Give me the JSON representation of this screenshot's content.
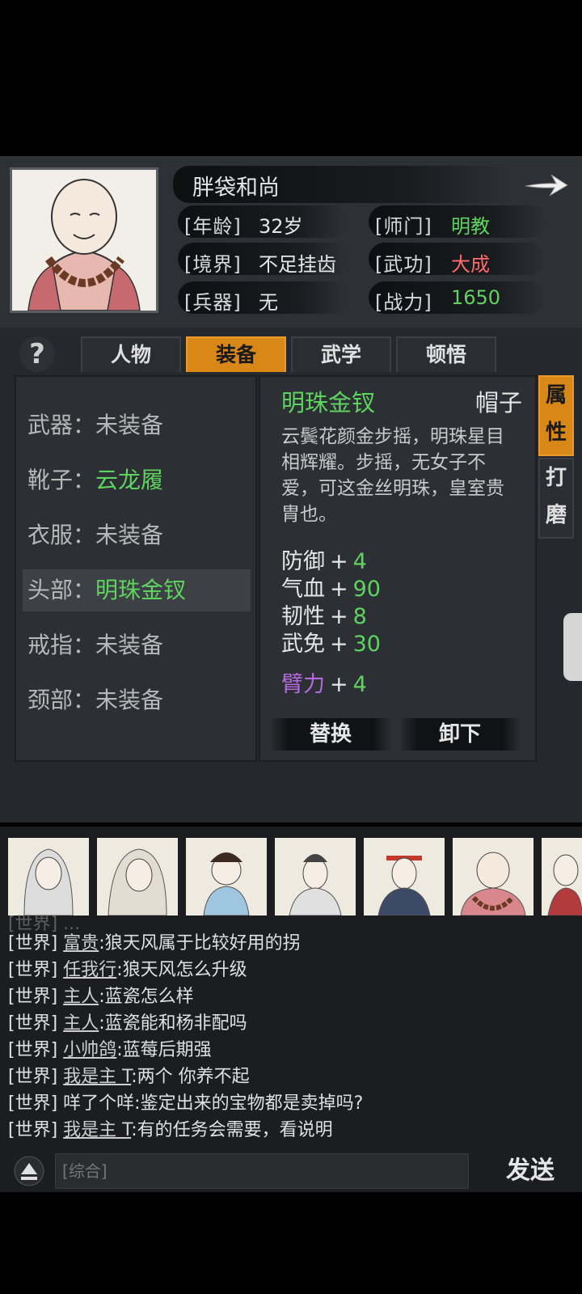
{
  "character": {
    "name": "胖袋和尚",
    "stats": [
      {
        "label": "[年龄]",
        "value": "32岁",
        "color": "#e6e6e6"
      },
      {
        "label": "[境界]",
        "value": "不足挂齿",
        "color": "#e6e6e6"
      },
      {
        "label": "[兵器]",
        "value": "无",
        "color": "#e6e6e6"
      },
      {
        "label": "[师门]",
        "value": "明教",
        "color": "#5fd35f"
      },
      {
        "label": "[武功]",
        "value": "大成",
        "color": "#ff6a6a"
      },
      {
        "label": "[战力]",
        "value": "1650",
        "color": "#5fd35f"
      }
    ]
  },
  "tabs": {
    "help": "?",
    "items": [
      "人物",
      "装备",
      "武学",
      "顿悟"
    ],
    "active": "装备"
  },
  "slots": [
    {
      "label": "武器：",
      "value": "未装备",
      "equipped": false
    },
    {
      "label": "靴子：",
      "value": "云龙履",
      "equipped": true
    },
    {
      "label": "衣服：",
      "value": "未装备",
      "equipped": false
    },
    {
      "label": "头部：",
      "value": "明珠金钗",
      "equipped": true,
      "selected": true
    },
    {
      "label": "戒指：",
      "value": "未装备",
      "equipped": false
    },
    {
      "label": "颈部：",
      "value": "未装备",
      "equipped": false
    }
  ],
  "item": {
    "name": "明珠金钗",
    "type": "帽子",
    "description": "云鬓花颜金步摇，明珠星目相辉耀。步摇，无女子不爱，可这金丝明珠，皇室贵胄也。",
    "stats": [
      {
        "name": "防御",
        "plus": "+",
        "value": "4"
      },
      {
        "name": "气血",
        "plus": "+",
        "value": "90"
      },
      {
        "name": "韧性",
        "plus": "+",
        "value": "8"
      },
      {
        "name": "武免",
        "plus": "+",
        "value": "30"
      }
    ],
    "special_stat": {
      "name": "臂力",
      "plus": "+",
      "value": "4"
    },
    "replace_label": "替换",
    "unequip_label": "卸下"
  },
  "side_tabs": {
    "attr": [
      "属",
      "性"
    ],
    "polish": [
      "打",
      "磨"
    ]
  },
  "chat": {
    "lines": [
      {
        "channel": "[世界]",
        "user": "富贵",
        "msg": ":狼天风属于比较好用的拐"
      },
      {
        "channel": "[世界]",
        "user": "任我行",
        "msg": ":狼天风怎么升级"
      },
      {
        "channel": "[世界]",
        "user": "主人",
        "msg": ":蓝瓷怎么样"
      },
      {
        "channel": "[世界]",
        "user": "主人",
        "msg": ":蓝瓷能和杨非配吗"
      },
      {
        "channel": "[世界]",
        "user": "小帅鸽",
        "msg": ":蓝莓后期强"
      },
      {
        "channel": "[世界]",
        "user": "我是主 T",
        "msg": ":两个 你养不起"
      },
      {
        "channel": "[世界]",
        "user": "",
        "msg": "咩了个咩:鉴定出来的宝物都是卖掉吗?"
      },
      {
        "channel": "[世界]",
        "user": "我是主 T",
        "msg": ":有的任务会需要，看说明"
      }
    ],
    "input_placeholder": "[综合]",
    "send_label": "发送"
  },
  "colors": {
    "accent": "#d98717",
    "green": "#5fd35f",
    "red": "#ff6a6a",
    "purple": "#b66ae0"
  }
}
